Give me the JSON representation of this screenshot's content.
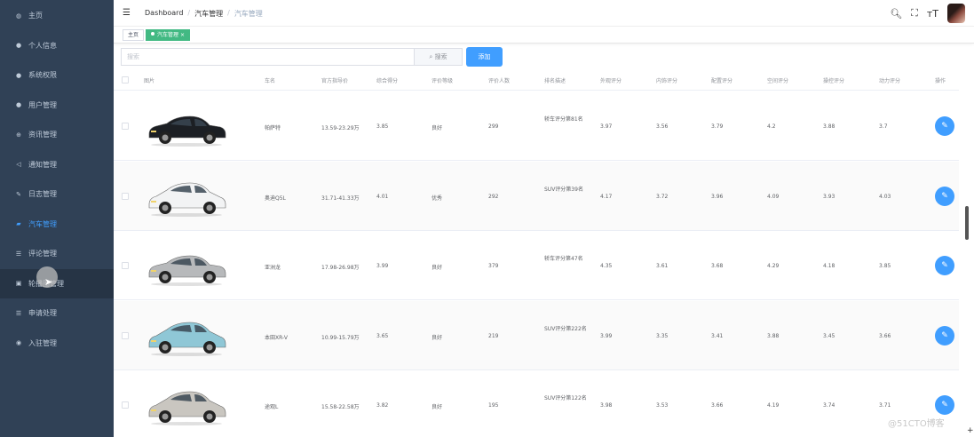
{
  "sidebar": {
    "items": [
      {
        "label": "主页",
        "icon": "dashboard-icon",
        "glyph": "◍"
      },
      {
        "label": "个人信息",
        "icon": "user-icon",
        "glyph": "●"
      },
      {
        "label": "系统权限",
        "icon": "user-key-icon",
        "glyph": "●"
      },
      {
        "label": "用户管理",
        "icon": "users-icon",
        "glyph": "●"
      },
      {
        "label": "资讯管理",
        "icon": "globe-icon",
        "glyph": "⊕"
      },
      {
        "label": "通知管理",
        "icon": "speaker-icon",
        "glyph": "◁"
      },
      {
        "label": "日志管理",
        "icon": "pencil-icon",
        "glyph": "✎"
      },
      {
        "label": "汽车管理",
        "icon": "car-icon",
        "glyph": "▰"
      },
      {
        "label": "评论管理",
        "icon": "list-icon",
        "glyph": "☰"
      },
      {
        "label": "轮播图管理",
        "icon": "image-icon",
        "glyph": "▣"
      },
      {
        "label": "申请处理",
        "icon": "list-icon",
        "glyph": "☰"
      },
      {
        "label": "入驻管理",
        "icon": "info-icon",
        "glyph": "◉"
      }
    ],
    "active_index": 7,
    "hover_index": 9
  },
  "navbar": {
    "breadcrumb": [
      "Dashboard",
      "汽车管理",
      "汽车管理"
    ],
    "separator": "/"
  },
  "tags": {
    "home": "主页",
    "current": "汽车管理",
    "close": "×"
  },
  "toolbar": {
    "search_placeholder": "搜索",
    "search_label": "搜索",
    "add_label": "添加"
  },
  "table": {
    "headers": [
      "图片",
      "车名",
      "官方指导价",
      "综合得分",
      "评价等级",
      "评价人数",
      "排名描述",
      "外观评分",
      "内饰评分",
      "配置评分",
      "空间评分",
      "操控评分",
      "动力评分",
      "操作"
    ],
    "rows": [
      {
        "name": "帕萨特",
        "price": "13.59-23.29万",
        "score": "3.85",
        "level": "良好",
        "count": "299",
        "rank": "轿车评分第81名",
        "exterior": "3.97",
        "interior": "3.56",
        "config": "3.79",
        "space": "4.2",
        "handling": "3.88",
        "power": "3.7",
        "car_color": "#1c1f24"
      },
      {
        "name": "奥迪Q5L",
        "price": "31.71-41.33万",
        "score": "4.01",
        "level": "优秀",
        "count": "292",
        "rank": "SUV评分第39名",
        "exterior": "4.17",
        "interior": "3.72",
        "config": "3.96",
        "space": "4.09",
        "handling": "3.93",
        "power": "4.03",
        "car_color": "#f2f3f4"
      },
      {
        "name": "亚洲龙",
        "price": "17.98-26.98万",
        "score": "3.99",
        "level": "良好",
        "count": "379",
        "rank": "轿车评分第47名",
        "exterior": "4.35",
        "interior": "3.61",
        "config": "3.68",
        "space": "4.29",
        "handling": "4.18",
        "power": "3.85",
        "car_color": "#b7b9bb"
      },
      {
        "name": "本田XR-V",
        "price": "10.99-15.79万",
        "score": "3.65",
        "level": "良好",
        "count": "219",
        "rank": "SUV评分第222名",
        "exterior": "3.99",
        "interior": "3.35",
        "config": "3.41",
        "space": "3.88",
        "handling": "3.45",
        "power": "3.66",
        "car_color": "#8fc7d6"
      },
      {
        "name": "途观L",
        "price": "15.58-22.58万",
        "score": "3.82",
        "level": "良好",
        "count": "195",
        "rank": "SUV评分第122名",
        "exterior": "3.98",
        "interior": "3.53",
        "config": "3.66",
        "space": "4.19",
        "handling": "3.74",
        "power": "3.71",
        "car_color": "#c9c6c0"
      }
    ]
  },
  "watermark": "@51CTO博客"
}
